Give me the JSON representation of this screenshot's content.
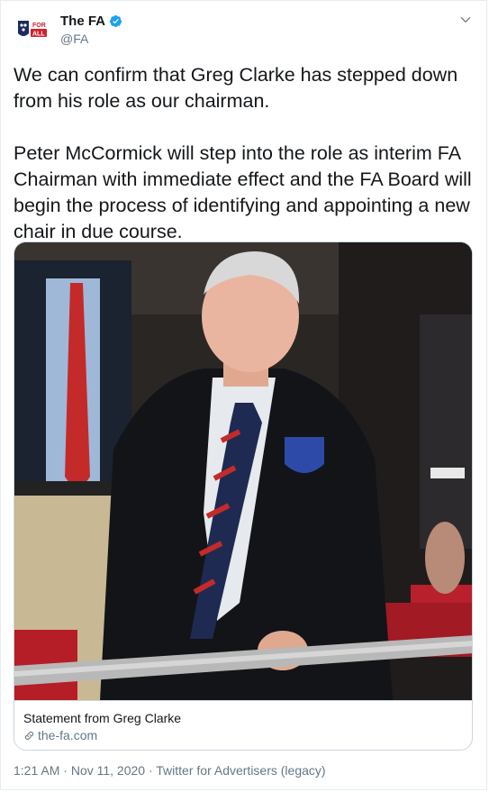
{
  "author": {
    "display_name": "The FA",
    "handle": "@FA",
    "avatar_text": "FOR ALL"
  },
  "tweet": {
    "text": "We can confirm that Greg Clarke has stepped down from his role as our chairman.\n\nPeter McCormick will step into the role as interim FA Chairman with immediate effect and the FA Board will begin the process of identifying and appointing a new chair in due course."
  },
  "card": {
    "title": "Statement from Greg Clarke",
    "domain": "the-fa.com"
  },
  "footer": {
    "time": "1:21 AM",
    "separator1": " · ",
    "date": "Nov 11, 2020",
    "separator2": " · ",
    "source": "Twitter for Advertisers (legacy)"
  },
  "colors": {
    "verified": "#1da1f2",
    "secondary_text": "#657786",
    "border": "#ccd6dd"
  },
  "icons": {
    "verified": "verified-badge-icon",
    "caret": "chevron-down-icon",
    "link": "link-icon"
  }
}
